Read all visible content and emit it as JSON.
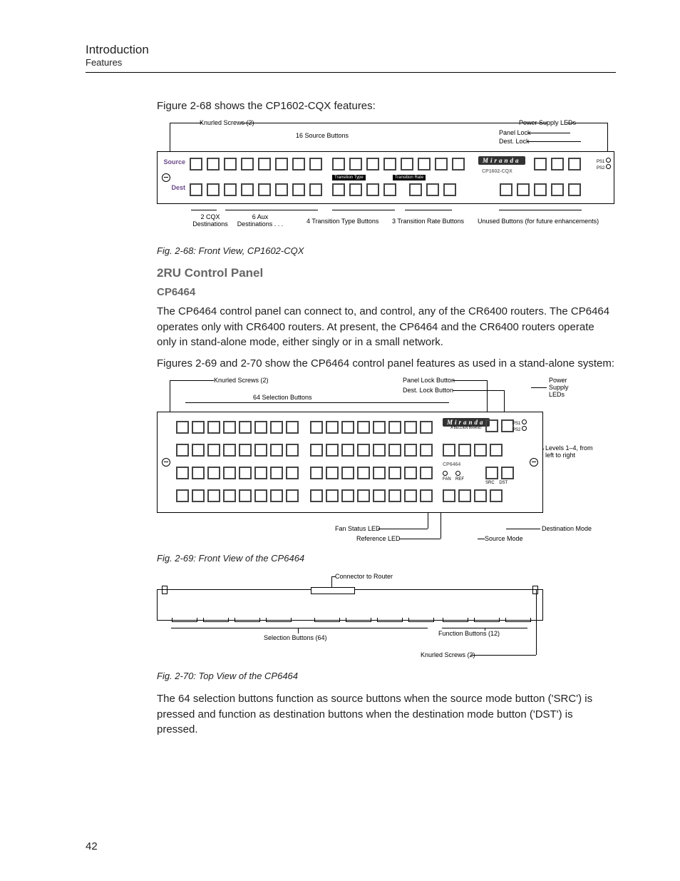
{
  "header": {
    "title": "Introduction",
    "subtitle": "Features"
  },
  "intro_para1": "Figure 2-68 shows the CP1602-CQX features:",
  "fig68": {
    "caption": "Fig. 2-68: Front View, CP1602-CQX",
    "callouts": {
      "knurled": "Knurled Screws (2)",
      "src_buttons": "16 Source Buttons",
      "power_leds": "Power Supply LEDs",
      "panel_lock": "Panel Lock",
      "dest_lock": "Dest. Lock",
      "two_cqx": "2 CQX\nDestinations",
      "six_aux": "6 Aux\nDestinations . . .",
      "trans_type_btns": "4 Transition Type Buttons",
      "trans_rate_btns": "3 Transition Rate Buttons",
      "unused": "Unused Buttons (for future enhancements)",
      "trans_type_bar": "Transition Type",
      "trans_rate_bar": "Transition Rate",
      "source_label": "Source",
      "dest_label": "Dest",
      "ps1": "PS1",
      "ps2": "PS2",
      "brand": "Miranda",
      "model": "CP1602-CQX"
    }
  },
  "h2_2ru": "2RU Control Panel",
  "h3_cp6464": "CP6464",
  "para_cp6464": "The CP6464 control panel can connect to, and control, any of the CR6400 routers. The CP6464 operates only with CR6400 routers. At present, the CP6464 and the CR6400 routers operate only in stand-alone mode, either singly or in a small network.",
  "para_figs": "Figures 2-69 and 2-70 show the CP6464 control panel features as used in a stand-alone system:",
  "fig69": {
    "caption": "Fig. 2-69: Front View of the CP6464",
    "callouts": {
      "knurled": "Knurled Screws (2)",
      "sel_buttons": "64 Selection Buttons",
      "panel_lock": "Panel Lock Button",
      "dest_lock": "Dest. Lock Button",
      "power_leds": "Power\nSupply\nLEDs",
      "levels": "Levels 1–4, from\nleft to right",
      "dest_mode": "Destination Mode",
      "src_mode": "Source Mode",
      "fan_led": "Fan Status LED",
      "ref_led": "Reference LED",
      "ps1": "PS1",
      "ps2": "PS2",
      "fan_txt": "FAN",
      "ref_txt": "REF",
      "src_txt": "SRC",
      "dst_txt": "DST",
      "brand": "Miranda",
      "sub_brand": "A BELDEN BRAND",
      "model": "CP6464"
    }
  },
  "fig70": {
    "caption": "Fig. 2-70: Top View of the CP6464",
    "callouts": {
      "connector": "Connector to Router",
      "sel_buttons": "Selection Buttons (64)",
      "func_buttons": "Function Buttons (12)",
      "knurled": "Knurled Screws (2)"
    }
  },
  "para_bottom": "The 64 selection buttons function as source buttons when the source mode button ('SRC') is pressed and function as destination buttons when the destination mode button ('DST') is pressed.",
  "page_number": "42"
}
